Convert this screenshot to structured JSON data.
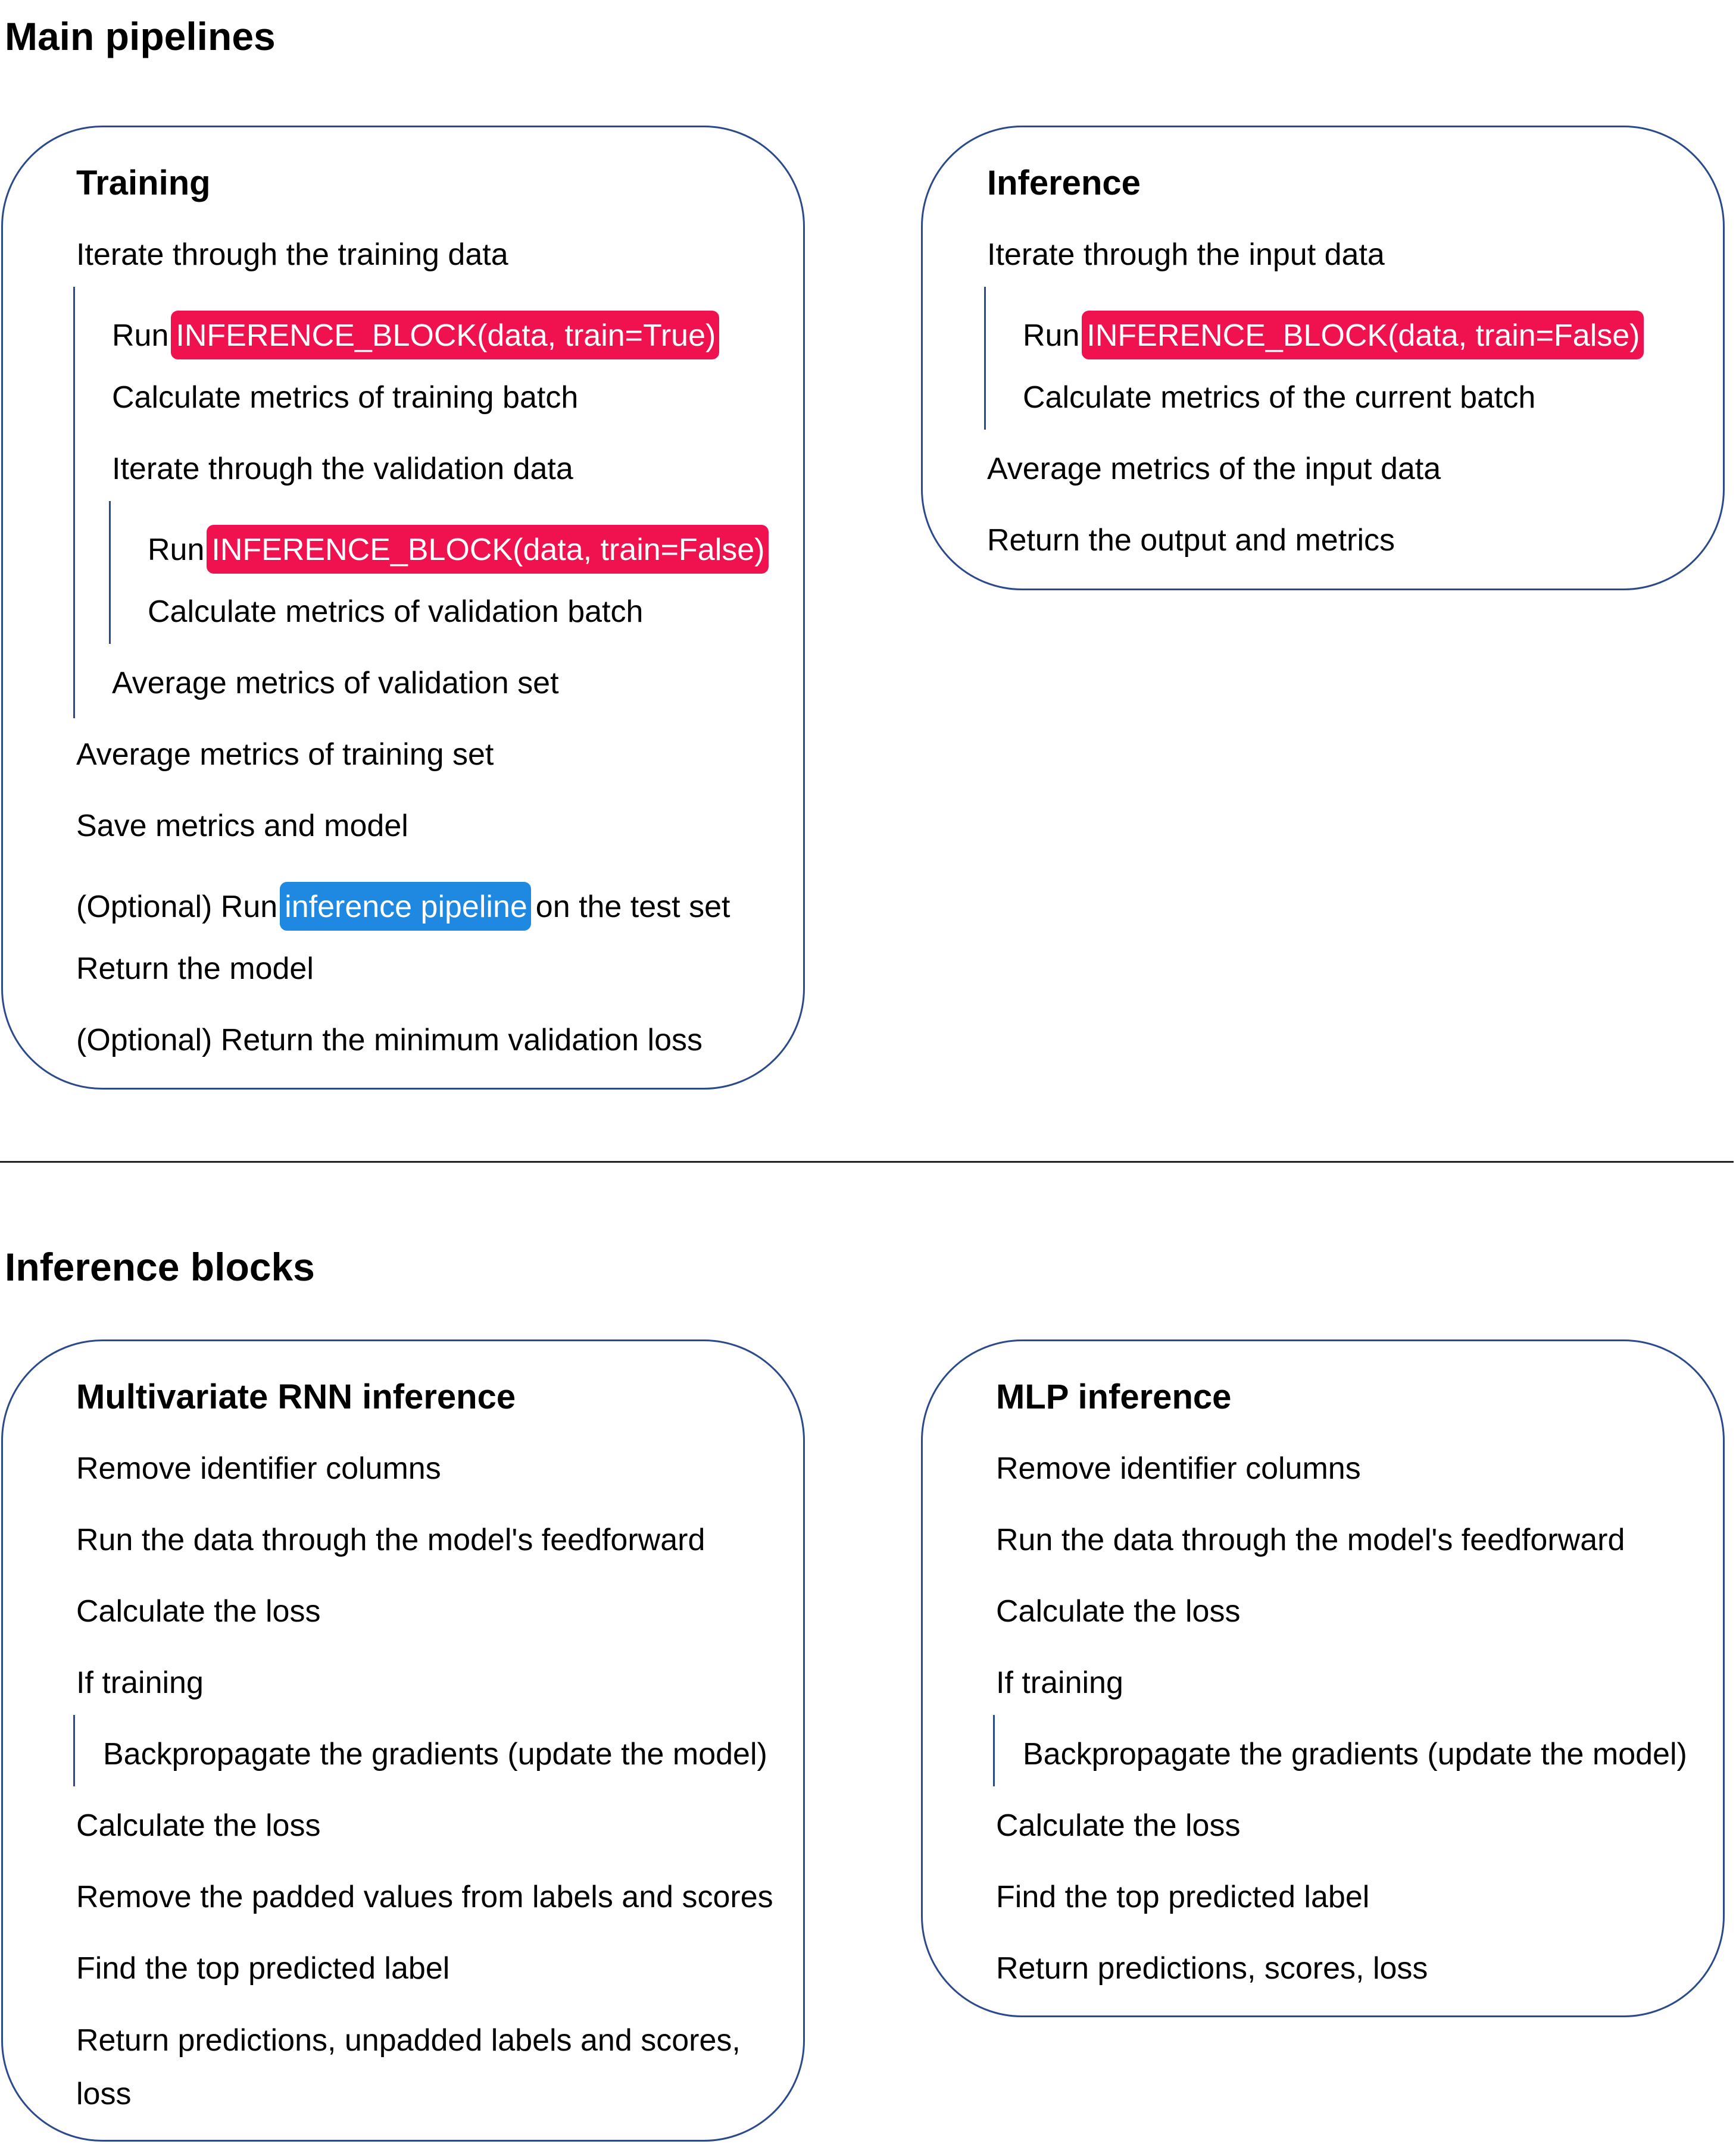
{
  "headings": {
    "main": "Main pipelines",
    "blocks": "Inference blocks"
  },
  "colors": {
    "box_border": "#2a4a8c",
    "highlight_red": "#f0124f",
    "highlight_blue": "#1f88e0"
  },
  "training": {
    "title": "Training",
    "iterate_train": "Iterate through the training data",
    "run_prefix_1": "Run",
    "run_block_1": "INFERENCE_BLOCK(data, train=True)",
    "calc_train": "Calculate metrics of training batch",
    "iterate_val": "Iterate through the validation data",
    "run_prefix_2": "Run",
    "run_block_2": "INFERENCE_BLOCK(data, train=False)",
    "calc_val": "Calculate metrics of validation batch",
    "avg_val": "Average metrics of validation set",
    "avg_train": "Average metrics of training set",
    "save": "Save metrics and model",
    "optional_run_prefix": "(Optional) Run",
    "optional_run_link": "inference pipeline",
    "optional_run_suffix": "on the test set",
    "return_model": "Return the model",
    "return_min_loss": "(Optional) Return the minimum validation loss"
  },
  "inference": {
    "title": "Inference",
    "iterate_input": "Iterate through the input data",
    "run_prefix": "Run",
    "run_block": "INFERENCE_BLOCK(data, train=False)",
    "calc_current": "Calculate metrics of the current batch",
    "avg_input": "Average metrics of the input data",
    "return_output": "Return the output and metrics"
  },
  "rnn": {
    "title": "Multivariate RNN inference",
    "remove_id": "Remove identifier columns",
    "feedforward": "Run the data through the model's feedforward",
    "calc_loss_1": "Calculate the loss",
    "if_training": "If training",
    "backprop": "Backpropagate the gradients (update the model)",
    "calc_loss_2": "Calculate the loss",
    "remove_padded": "Remove the padded values from labels and scores",
    "find_top": "Find the top predicted label",
    "return": "Return predictions, unpadded labels and scores, loss"
  },
  "mlp": {
    "title": "MLP inference",
    "remove_id": "Remove identifier columns",
    "feedforward": "Run the data through the model's feedforward",
    "calc_loss_1": "Calculate the loss",
    "if_training": "If training",
    "backprop": "Backpropagate the gradients (update the model)",
    "calc_loss_2": "Calculate the loss",
    "find_top": "Find the top predicted label",
    "return": "Return predictions, scores, loss"
  }
}
